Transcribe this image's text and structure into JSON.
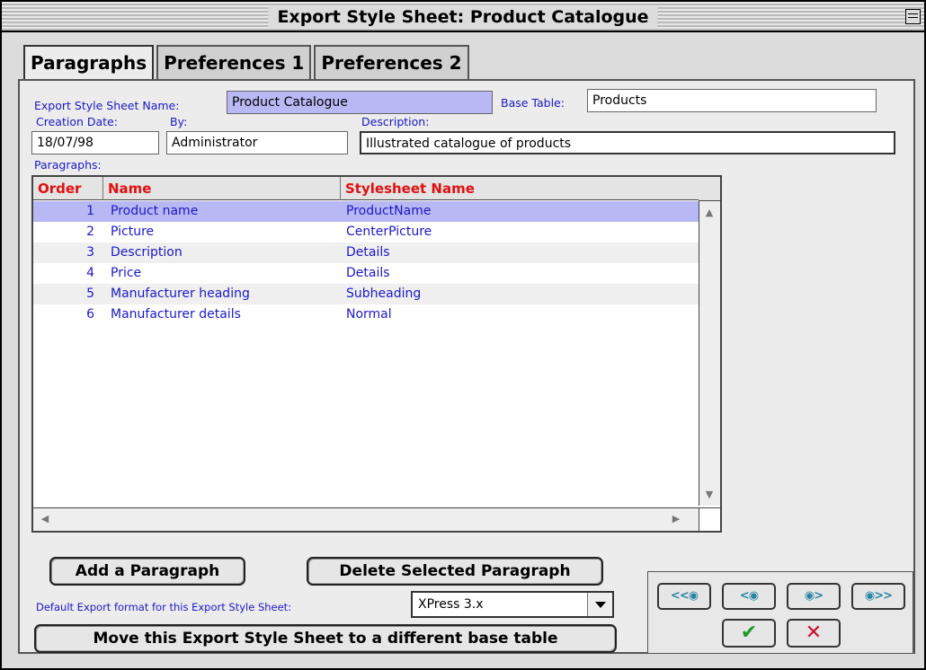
{
  "window": {
    "title": "Export Style Sheet: Product Catalogue"
  },
  "tabs": [
    {
      "label": "Paragraphs",
      "active": true
    },
    {
      "label": "Preferences 1",
      "active": false
    },
    {
      "label": "Preferences 2",
      "active": false
    }
  ],
  "form": {
    "ess_label": "Export Style Sheet  Name:",
    "name_value": "Product Catalogue",
    "base_table_label": "Base Table:",
    "base_table_value": "Products",
    "creation_date_label": "Creation Date:",
    "creation_date_value": "18/07/98",
    "by_label": "By:",
    "by_value": "Administrator",
    "description_label": "Description:",
    "description_value": "Illustrated catalogue of products",
    "paragraphs_label": "Paragraphs:"
  },
  "table": {
    "columns": [
      "Order",
      "Name",
      "Stylesheet Name"
    ],
    "rows": [
      {
        "order": "1",
        "name": "Product name",
        "stylesheet": "ProductName"
      },
      {
        "order": "2",
        "name": "Picture",
        "stylesheet": "CenterPicture"
      },
      {
        "order": "3",
        "name": "Description",
        "stylesheet": "Details"
      },
      {
        "order": "4",
        "name": "Price",
        "stylesheet": "Details"
      },
      {
        "order": "5",
        "name": "Manufacturer heading",
        "stylesheet": "Subheading"
      },
      {
        "order": "6",
        "name": "Manufacturer details",
        "stylesheet": "Normal"
      }
    ],
    "selected_row": 0
  },
  "buttons": {
    "add": "Add a Paragraph",
    "delete": "Delete Selected Paragraph",
    "move": "Move this Export Style Sheet to a different base table"
  },
  "export_format": {
    "label": "Default Export format for this Export Style Sheet:",
    "value": "XPress 3.x"
  },
  "nav": {
    "first": "<<◉",
    "prev": "<◉",
    "next": "◉>",
    "last": "◉>>",
    "ok_icon": "checkmark-icon",
    "cancel_icon": "x-icon"
  }
}
